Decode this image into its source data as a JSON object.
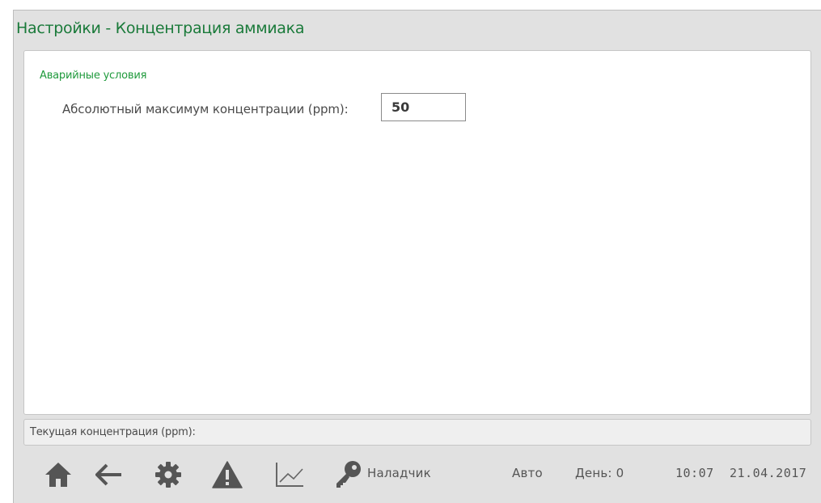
{
  "window": {
    "title": "Настройки - Концентрация аммиака"
  },
  "section": {
    "title": "Аварийные условия"
  },
  "field": {
    "label": "Абсолютный максимум концентрации (ppm):",
    "value": "50"
  },
  "status": {
    "label": "Текущая концентрация (ppm):"
  },
  "nav": {
    "icons": [
      "home-icon",
      "back-arrow-icon",
      "gear-icon",
      "warning-icon",
      "chart-icon",
      "key-icon"
    ],
    "user_label": "Наладчик",
    "mode": "Авто",
    "day_label": "День: 0",
    "time": "10:07",
    "date": "21.04.2017"
  },
  "colors": {
    "accent": "#1a7a3a",
    "icon": "#555555",
    "panel": "#e1e1e1"
  }
}
